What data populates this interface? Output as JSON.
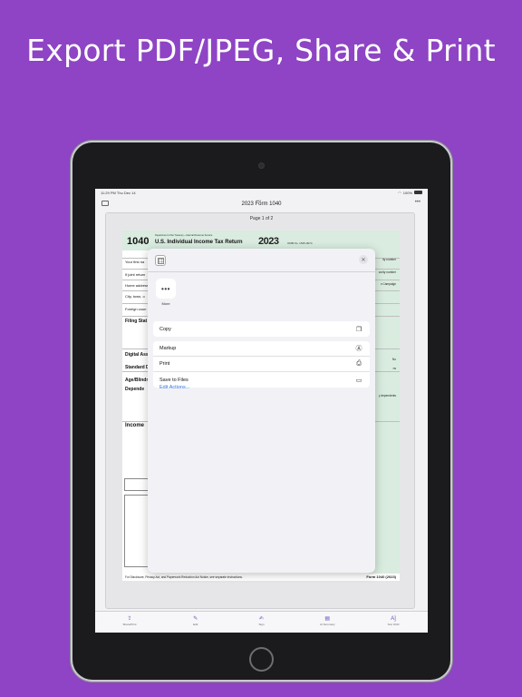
{
  "headline": "Export PDF/JPEG, Share & Print",
  "status_bar": {
    "time": "11:29 PM",
    "date": "Thu Dec 14",
    "battery": "100%"
  },
  "nav": {
    "title": "2023 Form 1040",
    "more": "•••"
  },
  "page_indicator": "Page 1 of 2",
  "form": {
    "number": "1040",
    "small_header": "Department of the Treasury—Internal Revenue Service",
    "title": "U.S. Individual Income Tax Return",
    "year": "2023",
    "omb": "OMB No. 1545-0074",
    "left_labels": [
      "Your first na",
      "If joint return",
      "Home address",
      "City, town, o",
      "Foreign coun",
      "Filing Stat",
      "Digital Assets",
      "Standard Deductio",
      "Age/Blindne",
      "Depende",
      "Income"
    ],
    "right_labels": [
      "ity number",
      "curity number",
      "n Campaign",
      "ns",
      "y dependents",
      "No"
    ],
    "footer": "For Disclosure, Privacy Act, and Paperwork Reduction Act Notice, see separate instructions.",
    "footer_right": "Form 1040 (2023)"
  },
  "share_sheet": {
    "close_icon": "close-icon",
    "more_app_label": "More",
    "actions_group1": [
      {
        "label": "Copy",
        "icon": "copy-icon"
      }
    ],
    "actions_group2": [
      {
        "label": "Markup",
        "icon": "markup-icon"
      },
      {
        "label": "Print",
        "icon": "printer-icon"
      },
      {
        "label": "Save to Files",
        "icon": "folder-icon"
      }
    ],
    "edit_actions": "Edit Actions..."
  },
  "tabbar": [
    {
      "label": "Share/Print",
      "icon": "share-icon"
    },
    {
      "label": "Edit",
      "icon": "edit-icon"
    },
    {
      "label": "Sign",
      "icon": "sign-icon"
    },
    {
      "label": "AI Summary",
      "icon": "ai-summary-icon"
    },
    {
      "label": "Text OCR",
      "icon": "text-ocr-icon"
    }
  ],
  "colors": {
    "background": "#8e44c4",
    "accent": "#2f7ae5",
    "form_green": "#d9ecdf"
  }
}
